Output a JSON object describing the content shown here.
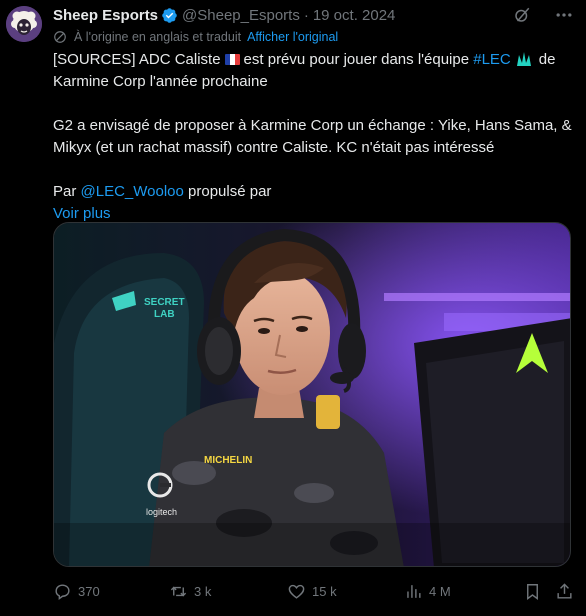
{
  "author": {
    "name": "Sheep Esports",
    "handle": "@Sheep_Esports",
    "separator": "·",
    "date": "19 oct. 2024"
  },
  "translation": {
    "note": "À l'origine en anglais et traduit",
    "show_original": "Afficher l'original"
  },
  "tweet": {
    "line1_before_flag": "[SOURCES] ADC Caliste",
    "line1_after_flag": "est prévu pour jouer dans l'équipe",
    "hashtag": "#LEC",
    "line1_end": "de",
    "line2": "Karmine Corp l'année prochaine",
    "para2": "G2 a envisagé de proposer à Karmine Corp un échange : Yike, Hans Sama, & Mikyx (et un rachat massif) contre Caliste. KC n'était pas intéressé",
    "para3_before": "Par",
    "mention": "@LEC_Wooloo",
    "para3_after": "propulsé par",
    "see_more": "Voir plus"
  },
  "media": {
    "icon": "player-photo",
    "jersey_brand": "MICHELIN",
    "chair_brand": "SECRETLAB",
    "logitech_label": "logitech"
  },
  "actions": {
    "replies": "370",
    "reposts": "3 k",
    "likes": "15 k",
    "views": "4 M"
  },
  "colors": {
    "background": "#000000",
    "text": "#e7e9ea",
    "muted": "#71767b",
    "link": "#1d9bf0"
  }
}
